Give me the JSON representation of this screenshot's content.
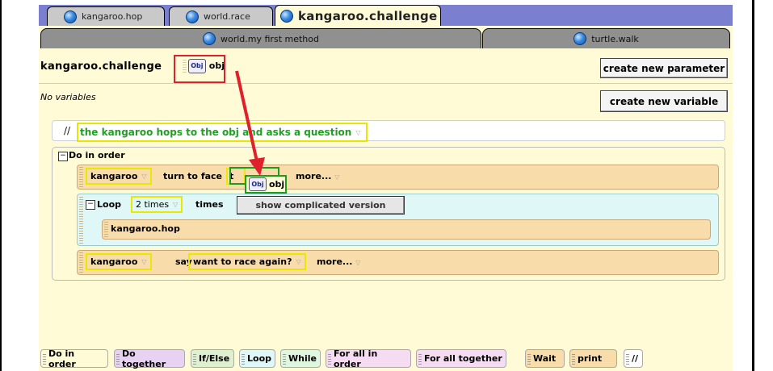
{
  "tabs_row1": [
    {
      "label": "kangaroo.hop",
      "active": false
    },
    {
      "label": "world.race",
      "active": false
    },
    {
      "label": "kangaroo.challenge",
      "active": true
    }
  ],
  "tabs_row2": [
    {
      "label": "world.my first method"
    },
    {
      "label": "turtle.walk"
    }
  ],
  "method": {
    "title": "kangaroo.challenge",
    "param_icon": "Obj",
    "param_name": "obj",
    "no_variables": "No variables",
    "create_param_btn": "create new parameter",
    "create_var_btn": "create new variable"
  },
  "comment": {
    "slashes": "//",
    "text": "the kangaroo hops to the obj and asks a question"
  },
  "code": {
    "do_in_order_label": "Do in order",
    "stmt1": {
      "object": "kangaroo",
      "method": "turn to face",
      "target_partial": "t",
      "more": "more..."
    },
    "loop": {
      "label": "Loop",
      "count": "2 times",
      "suffix": "times",
      "complicated_btn": "show complicated version",
      "inner": "kangaroo.hop"
    },
    "stmt2": {
      "object": "kangaroo",
      "method": "say",
      "value": "want to race again?",
      "more": "more..."
    }
  },
  "dragged": {
    "icon": "Obj",
    "name": "obj"
  },
  "palette": [
    {
      "label": "Do in order",
      "color": "#fffbd7"
    },
    {
      "label": "Do together",
      "color": "#e8d2f2"
    },
    {
      "label": "If/Else",
      "color": "#dff0d0"
    },
    {
      "label": "Loop",
      "color": "#dff7f7"
    },
    {
      "label": "While",
      "color": "#dff7df"
    },
    {
      "label": "For all in order",
      "color": "#f6dcf2"
    },
    {
      "label": "For all together",
      "color": "#f6dcf2"
    },
    {
      "label": "Wait",
      "color": "#f8dcaa"
    },
    {
      "label": "print",
      "color": "#f8dcaa"
    },
    {
      "label": "//",
      "color": "#ffffff"
    }
  ],
  "colors": {
    "tab_bg": "#7b7fcf",
    "editor_bg": "#fffbd7",
    "highlight_red": "#e0202a",
    "drop_green": "#1c9c1c",
    "comment_green": "#21a021"
  }
}
